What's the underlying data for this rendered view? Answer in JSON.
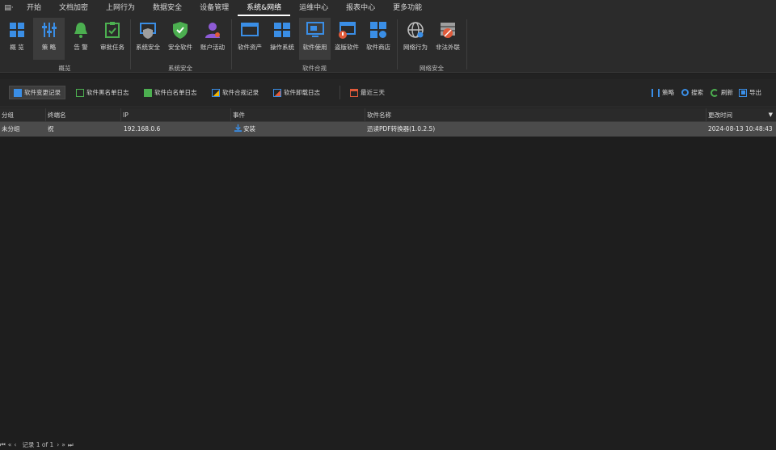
{
  "menubar": {
    "app_icon": "▤·",
    "items": [
      "开始",
      "文档加密",
      "上网行为",
      "数据安全",
      "设备管理",
      "系统&网络",
      "运维中心",
      "报表中心",
      "更多功能"
    ],
    "active_index": 5
  },
  "ribbon": {
    "buttons": [
      {
        "label": "概 览",
        "icon": "overview-icon"
      },
      {
        "label": "策 略",
        "icon": "policy-icon"
      },
      {
        "label": "告 警",
        "icon": "alarm-bell-icon"
      },
      {
        "label": "审批任务",
        "icon": "approval-task-icon"
      },
      {
        "label": "系统安全",
        "icon": "system-security-icon"
      },
      {
        "label": "安全软件",
        "icon": "security-software-icon"
      },
      {
        "label": "账户活动",
        "icon": "account-activity-icon"
      },
      {
        "label": "软件资产",
        "icon": "software-assets-icon"
      },
      {
        "label": "操作系统",
        "icon": "operating-system-icon"
      },
      {
        "label": "软件使用",
        "icon": "software-usage-icon"
      },
      {
        "label": "盗版软件",
        "icon": "pirated-software-icon"
      },
      {
        "label": "软件商店",
        "icon": "software-store-icon"
      },
      {
        "label": "网络行为",
        "icon": "network-behavior-icon"
      },
      {
        "label": "非法外联",
        "icon": "illegal-outreach-icon"
      }
    ],
    "groups": [
      "概览",
      "系统安全",
      "软件合规",
      "网络安全"
    ]
  },
  "toolbar": {
    "items": [
      "软件变更记录",
      "软件黑名单日志",
      "软件白名单日志",
      "软件合规记录",
      "软件卸载日志",
      "最近三天"
    ],
    "right": [
      "策略",
      "搜索",
      "刷新",
      "导出"
    ]
  },
  "table": {
    "columns": [
      "分组",
      "终端名",
      "IP",
      "事件",
      "软件名称",
      "更改时间"
    ],
    "rows": [
      {
        "group": "未分组",
        "terminal": "祝",
        "ip": "192.168.0.6",
        "event": "安装",
        "software": "迅读PDF转换器(1.0.2.5)",
        "time": "2024-08-13 10:48:43"
      }
    ]
  },
  "status": {
    "nav": [
      "⏮",
      "«",
      "‹"
    ],
    "record_text": "记录 1 of 1",
    "nav_end": [
      "›",
      "»",
      "⏭"
    ]
  },
  "colors": {
    "accent_blue": "#3a8ee6",
    "green": "#4caf50",
    "purple": "#8e5bd6",
    "red": "#e05a3a",
    "selected_row": "#4b4b4b"
  }
}
